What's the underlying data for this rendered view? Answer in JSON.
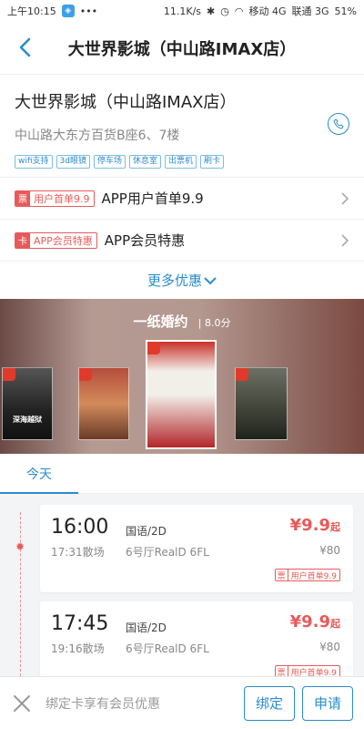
{
  "status_bar": {
    "time": "上午10:15",
    "speed": "11.1K/s",
    "carrier1": "移动 4G",
    "carrier2": "联通 3G",
    "battery": "51%"
  },
  "header": {
    "title": "大世界影城（中山路IMAX店）"
  },
  "cinema": {
    "name": "大世界影城（中山路IMAX店）",
    "address": "中山路大东方百货B座6、7楼",
    "tags": [
      "wifi支持",
      "3d眼镜",
      "停车场",
      "休息室",
      "出票机",
      "刷卡"
    ]
  },
  "offers": [
    {
      "badge_icon": "票",
      "badge_text": "用户首单9.9",
      "label": "APP用户首单9.9"
    },
    {
      "badge_icon": "卡",
      "badge_text": "APP会员特惠",
      "label": "APP会员特惠"
    }
  ],
  "more_offers": "更多优惠",
  "featured_movie": {
    "title": "一纸婚约",
    "score": "8.0分"
  },
  "posters": [
    {
      "text": "深海越狱"
    },
    {
      "text": ""
    },
    {
      "text": ""
    },
    {
      "text": ""
    }
  ],
  "date_tabs": {
    "today": "今天"
  },
  "showtimes": [
    {
      "start": "16:00",
      "end": "17:31散场",
      "lang": "国语/2D",
      "hall": "6号厅RealD 6FL",
      "price": "¥9.9",
      "price_suffix": "起",
      "original_price": "¥80",
      "badge_icon": "票",
      "badge_text": "用户首单9.9"
    },
    {
      "start": "17:45",
      "end": "19:16散场",
      "lang": "国语/2D",
      "hall": "6号厅RealD 6FL",
      "price": "¥9.9",
      "price_suffix": "起",
      "original_price": "¥80",
      "badge_icon": "票",
      "badge_text": "用户首单9.9"
    }
  ],
  "bottom_bar": {
    "hint": "绑定卡享有会员优惠",
    "bind_label": "绑定",
    "apply_label": "申请"
  },
  "colors": {
    "accent": "#2a8ccc",
    "price": "#e85a5a"
  }
}
